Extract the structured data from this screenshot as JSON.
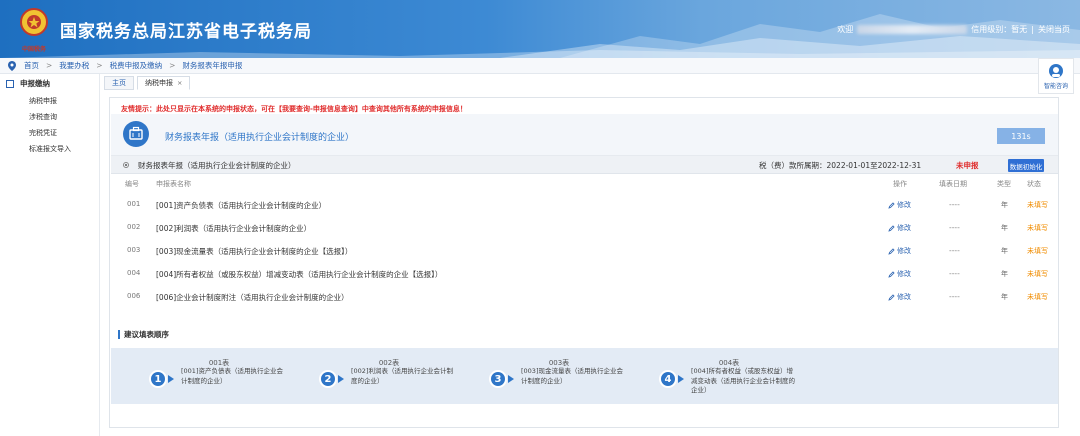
{
  "header": {
    "title": "国家税务总局江苏省电子税务局",
    "logo_text": "中国税务",
    "welcome": "欢迎",
    "credit_level": "信用级别：暂无",
    "close_current": "关闭当页",
    "separator": "|"
  },
  "breadcrumb": [
    "首页",
    "我要办税",
    "税费申报及缴纳",
    "财务报表年报申报"
  ],
  "sidebar": {
    "section": "申报缴纳",
    "items": [
      "纳税申报",
      "涉税查询",
      "完税凭证",
      "标准报文导入"
    ]
  },
  "tabs": [
    {
      "label": "主页",
      "active": false
    },
    {
      "label": "纳税申报",
      "active": true,
      "close": "×"
    }
  ],
  "consult": {
    "label": "智能咨询",
    "icon": "headset-icon"
  },
  "main": {
    "tip": "友情提示：此处只显示在本系统的申报状态，可在【我要查询-申报信息查询】中查询其他所有系统的申报信息！",
    "title": "财务报表年报（适用执行企业会计制度的企业）",
    "size_badge": "131s",
    "group": {
      "name": "财务报表年报（适用执行企业会计制度的企业）",
      "period": "税（费）款所属期：2022-01-01至2022-12-31",
      "status": "未申报",
      "init_button": "数据初始化"
    },
    "columns": {
      "code": "编号",
      "name": "申报表名称",
      "op": "操作",
      "date": "填表日期",
      "type": "类型",
      "status": "状态"
    },
    "rows": [
      {
        "code": "001",
        "name": "[001]资产负债表（适用执行企业会计制度的企业）",
        "op": "修改",
        "date": "----",
        "type": "年",
        "status": "未填写"
      },
      {
        "code": "002",
        "name": "[002]利润表（适用执行企业会计制度的企业）",
        "op": "修改",
        "date": "----",
        "type": "年",
        "status": "未填写"
      },
      {
        "code": "003",
        "name": "[003]现金流量表（适用执行企业会计制度的企业【选报】）",
        "op": "修改",
        "date": "----",
        "type": "年",
        "status": "未填写"
      },
      {
        "code": "004",
        "name": "[004]所有者权益（或股东权益）增减变动表（适用执行企业会计制度的企业【选报】）",
        "op": "修改",
        "date": "----",
        "type": "年",
        "status": "未填写"
      },
      {
        "code": "006",
        "name": "[006]企业会计制度附注（适用执行企业会计制度的企业）",
        "op": "修改",
        "date": "----",
        "type": "年",
        "status": "未填写"
      }
    ],
    "order_title": "建议填表顺序",
    "steps": [
      {
        "num": "1",
        "head": "001表",
        "desc": "[001]资产负债表（适用执行企业会计制度的企业）"
      },
      {
        "num": "2",
        "head": "002表",
        "desc": "[002]利润表（适用执行企业会计制度的企业）"
      },
      {
        "num": "3",
        "head": "003表",
        "desc": "[003]现金流量表（适用执行企业会计制度的企业）"
      },
      {
        "num": "4",
        "head": "004表",
        "desc": "[004]所有者权益（或股东权益）增减变动表（适用执行企业会计制度的企业）"
      }
    ]
  }
}
